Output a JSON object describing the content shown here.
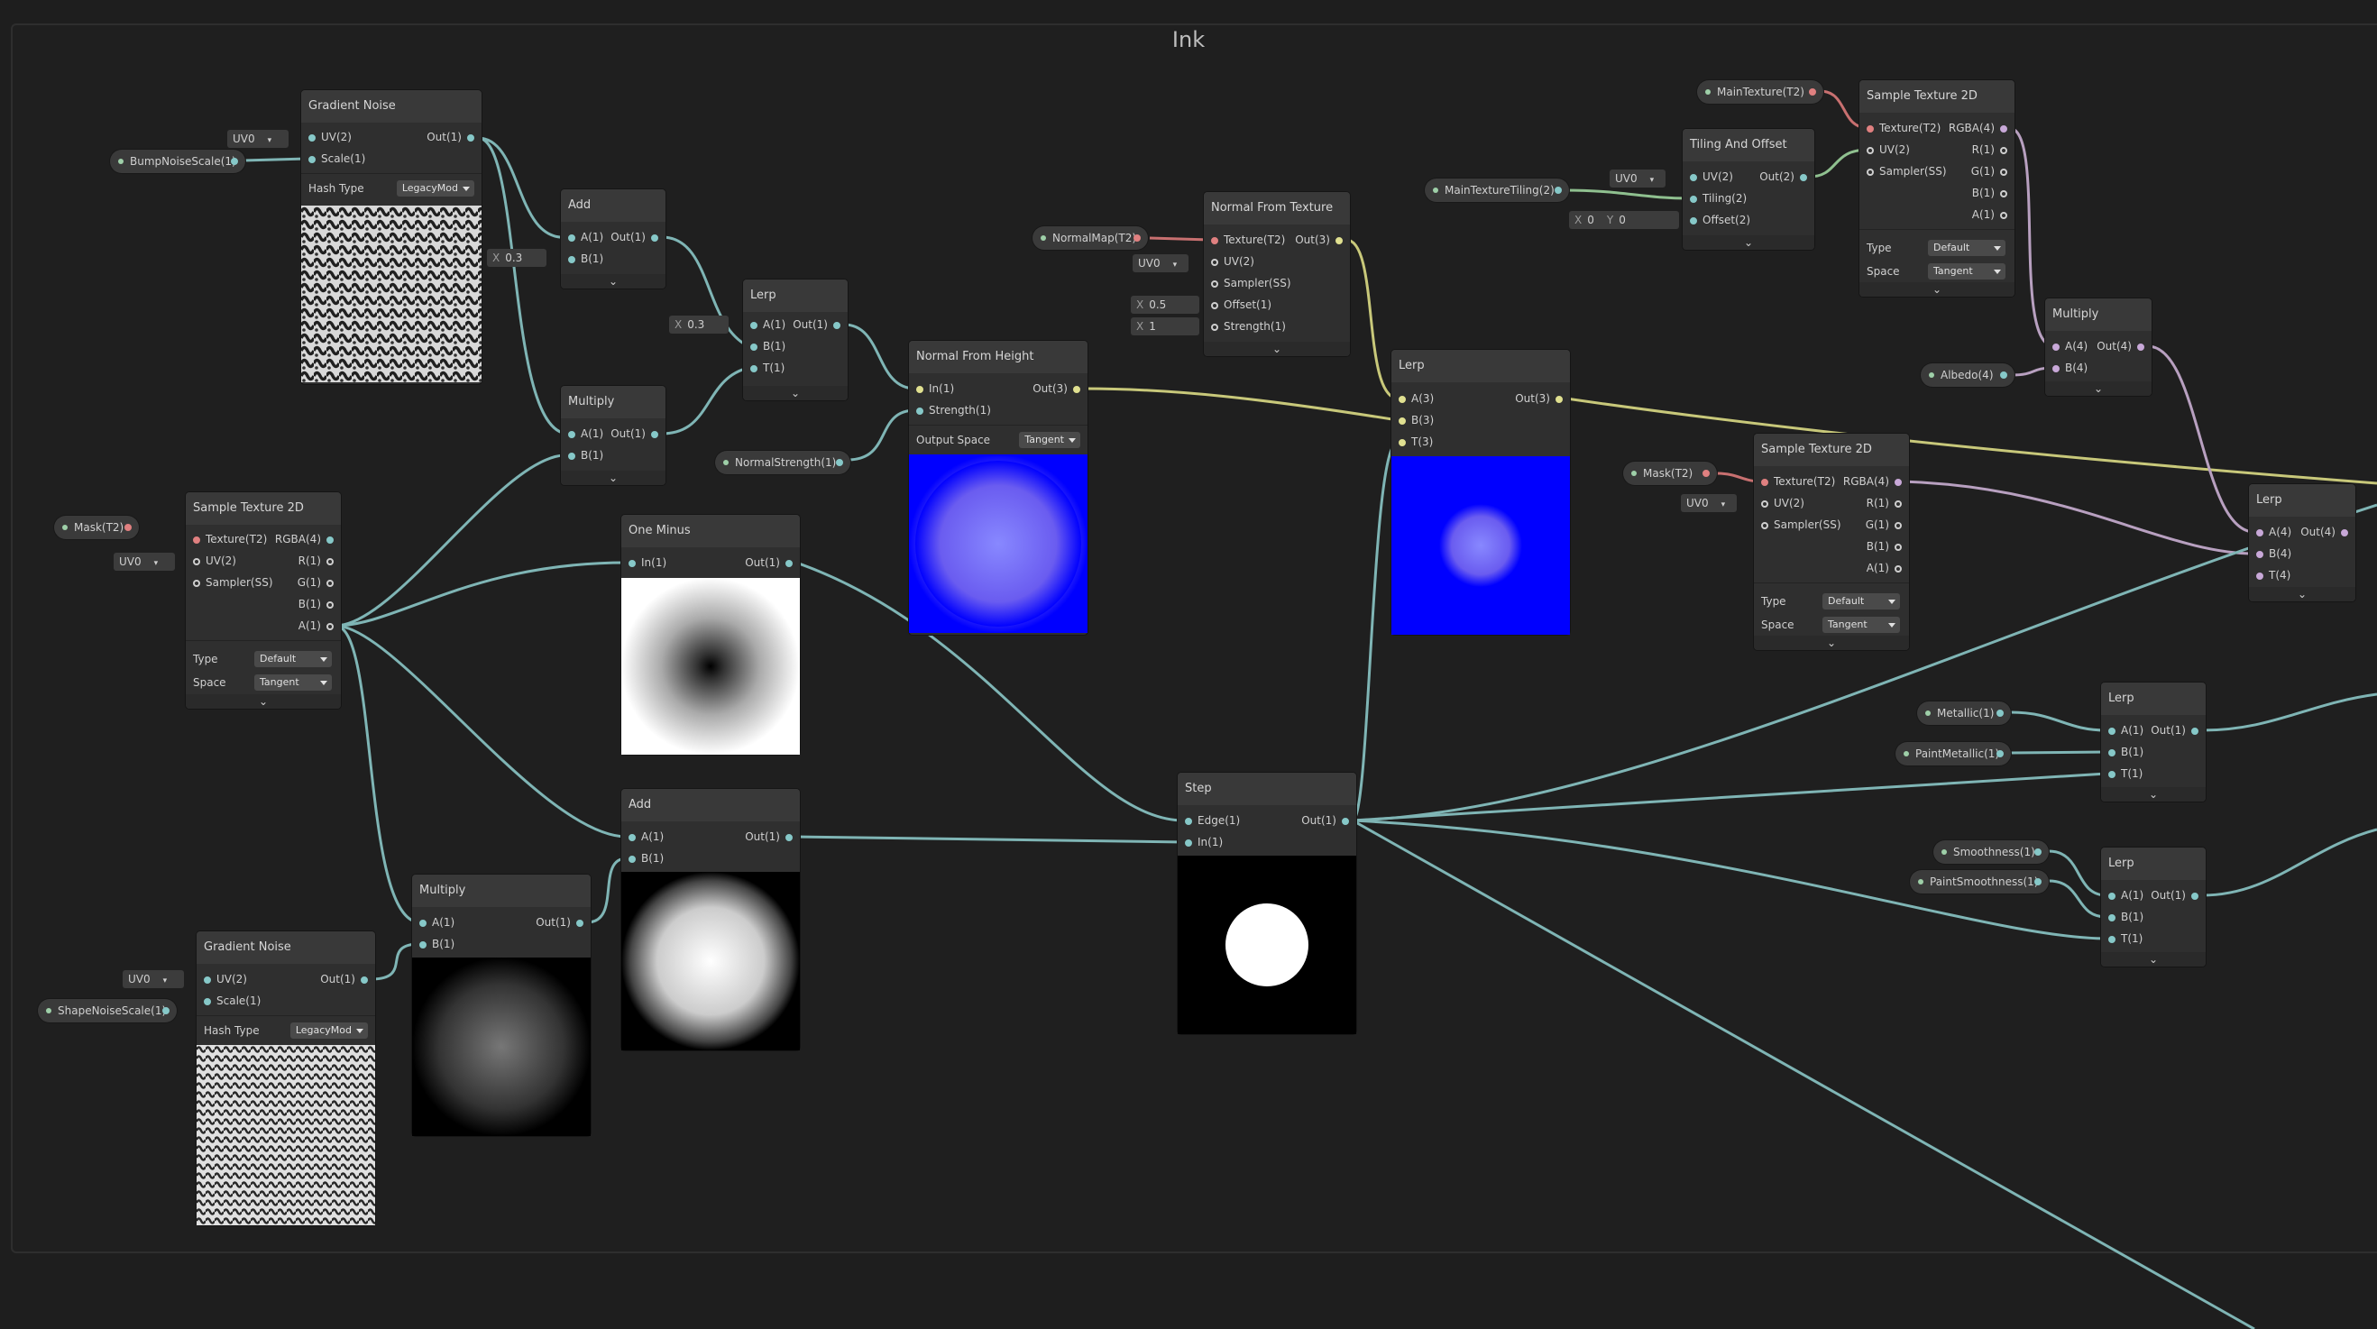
{
  "graph": {
    "title": "Ink"
  },
  "colors": {
    "background": "#1e1e1e",
    "node": "#2f2f2f",
    "header": "#393939",
    "wire_teal": "#7fb5b5",
    "wire_yellow": "#c8c87a",
    "wire_pink": "#c87070",
    "wire_lilac": "#b8a0c0",
    "wire_green": "#8fc08f"
  },
  "nodes": {
    "gn1": {
      "title": "Gradient Noise",
      "in1": "UV(2)",
      "in2": "Scale(1)",
      "out": "Out(1)",
      "hash_label": "Hash Type",
      "hash_value": "LegacyMod",
      "uv": "UV0"
    },
    "add1": {
      "title": "Add",
      "in1": "A(1)",
      "in2": "B(1)",
      "out": "Out(1)",
      "x_label": "X",
      "x_value": "0.3"
    },
    "mul1": {
      "title": "Multiply",
      "in1": "A(1)",
      "in2": "B(1)",
      "out": "Out(1)"
    },
    "lerp1": {
      "title": "Lerp",
      "in1": "A(1)",
      "in2": "B(1)",
      "in3": "T(1)",
      "out": "Out(1)",
      "x_label": "X",
      "x_value": "0.3"
    },
    "nfh": {
      "title": "Normal From Height",
      "in1": "In(1)",
      "in2": "Strength(1)",
      "out": "Out(3)",
      "os_label": "Output Space",
      "os_value": "Tangent"
    },
    "nft": {
      "title": "Normal From Texture",
      "in1": "Texture(T2)",
      "in2": "UV(2)",
      "in3": "Sampler(SS)",
      "in4": "Offset(1)",
      "in5": "Strength(1)",
      "out": "Out(3)",
      "uv": "UV0",
      "x_label": "X",
      "offset_value": "0.5",
      "strength_value": "1"
    },
    "lerp2": {
      "title": "Lerp",
      "in1": "A(3)",
      "in2": "B(3)",
      "in3": "T(3)",
      "out": "Out(3)"
    },
    "tao": {
      "title": "Tiling And Offset",
      "in1": "UV(2)",
      "in2": "Tiling(2)",
      "in3": "Offset(2)",
      "out": "Out(2)",
      "uv": "UV0",
      "x_label": "X",
      "x_value": "0",
      "y_label": "Y",
      "y_value": "0"
    },
    "st_top": {
      "title": "Sample Texture 2D",
      "in1": "Texture(T2)",
      "in2": "UV(2)",
      "in3": "Sampler(SS)",
      "out1": "RGBA(4)",
      "out2": "R(1)",
      "out3": "G(1)",
      "out4": "B(1)",
      "out5": "A(1)",
      "type_label": "Type",
      "type_value": "Default",
      "space_label": "Space",
      "space_value": "Tangent"
    },
    "mul_top": {
      "title": "Multiply",
      "in1": "A(4)",
      "in2": "B(4)",
      "out": "Out(4)"
    },
    "st_mid": {
      "title": "Sample Texture 2D",
      "in1": "Texture(T2)",
      "in2": "UV(2)",
      "in3": "Sampler(SS)",
      "out1": "RGBA(4)",
      "out2": "R(1)",
      "out3": "G(1)",
      "out4": "B(1)",
      "out5": "A(1)",
      "type_label": "Type",
      "type_value": "Default",
      "space_label": "Space",
      "space_value": "Tangent",
      "uv": "UV0"
    },
    "lerp4": {
      "title": "Lerp",
      "in1": "A(4)",
      "in2": "B(4)",
      "in3": "T(4)",
      "out": "Out(4)"
    },
    "st_left": {
      "title": "Sample Texture 2D",
      "in1": "Texture(T2)",
      "in2": "UV(2)",
      "in3": "Sampler(SS)",
      "out1": "RGBA(4)",
      "out2": "R(1)",
      "out3": "G(1)",
      "out4": "B(1)",
      "out5": "A(1)",
      "type_label": "Type",
      "type_value": "Default",
      "space_label": "Space",
      "space_value": "Tangent",
      "uv": "UV0"
    },
    "oneminus": {
      "title": "One Minus",
      "in1": "In(1)",
      "out": "Out(1)"
    },
    "step": {
      "title": "Step",
      "in1": "Edge(1)",
      "in2": "In(1)",
      "out": "Out(1)"
    },
    "add2": {
      "title": "Add",
      "in1": "A(1)",
      "in2": "B(1)",
      "out": "Out(1)"
    },
    "mul2": {
      "title": "Multiply",
      "in1": "A(1)",
      "in2": "B(1)",
      "out": "Out(1)"
    },
    "gn2": {
      "title": "Gradient Noise",
      "in1": "UV(2)",
      "in2": "Scale(1)",
      "out": "Out(1)",
      "hash_label": "Hash Type",
      "hash_value": "LegacyMod",
      "uv": "UV0"
    },
    "lerp_met": {
      "title": "Lerp",
      "in1": "A(1)",
      "in2": "B(1)",
      "in3": "T(1)",
      "out": "Out(1)"
    },
    "lerp_smo": {
      "title": "Lerp",
      "in1": "A(1)",
      "in2": "B(1)",
      "in3": "T(1)",
      "out": "Out(1)"
    }
  },
  "properties": {
    "bump": "BumpNoiseScale(1)",
    "mask_left": "Mask(T2)",
    "shape": "ShapeNoiseScale(1)",
    "normalstrength": "NormalStrength(1)",
    "normalmap": "NormalMap(T2)",
    "maintex": "MainTexture(T2)",
    "tiling": "MainTextureTiling(2)",
    "albedo": "Albedo(4)",
    "mask_right": "Mask(T2)",
    "metallic": "Metallic(1)",
    "paintmetallic": "PaintMetallic(1)",
    "smoothness": "Smoothness(1)",
    "paintsmoothness": "PaintSmoothness(1)"
  }
}
